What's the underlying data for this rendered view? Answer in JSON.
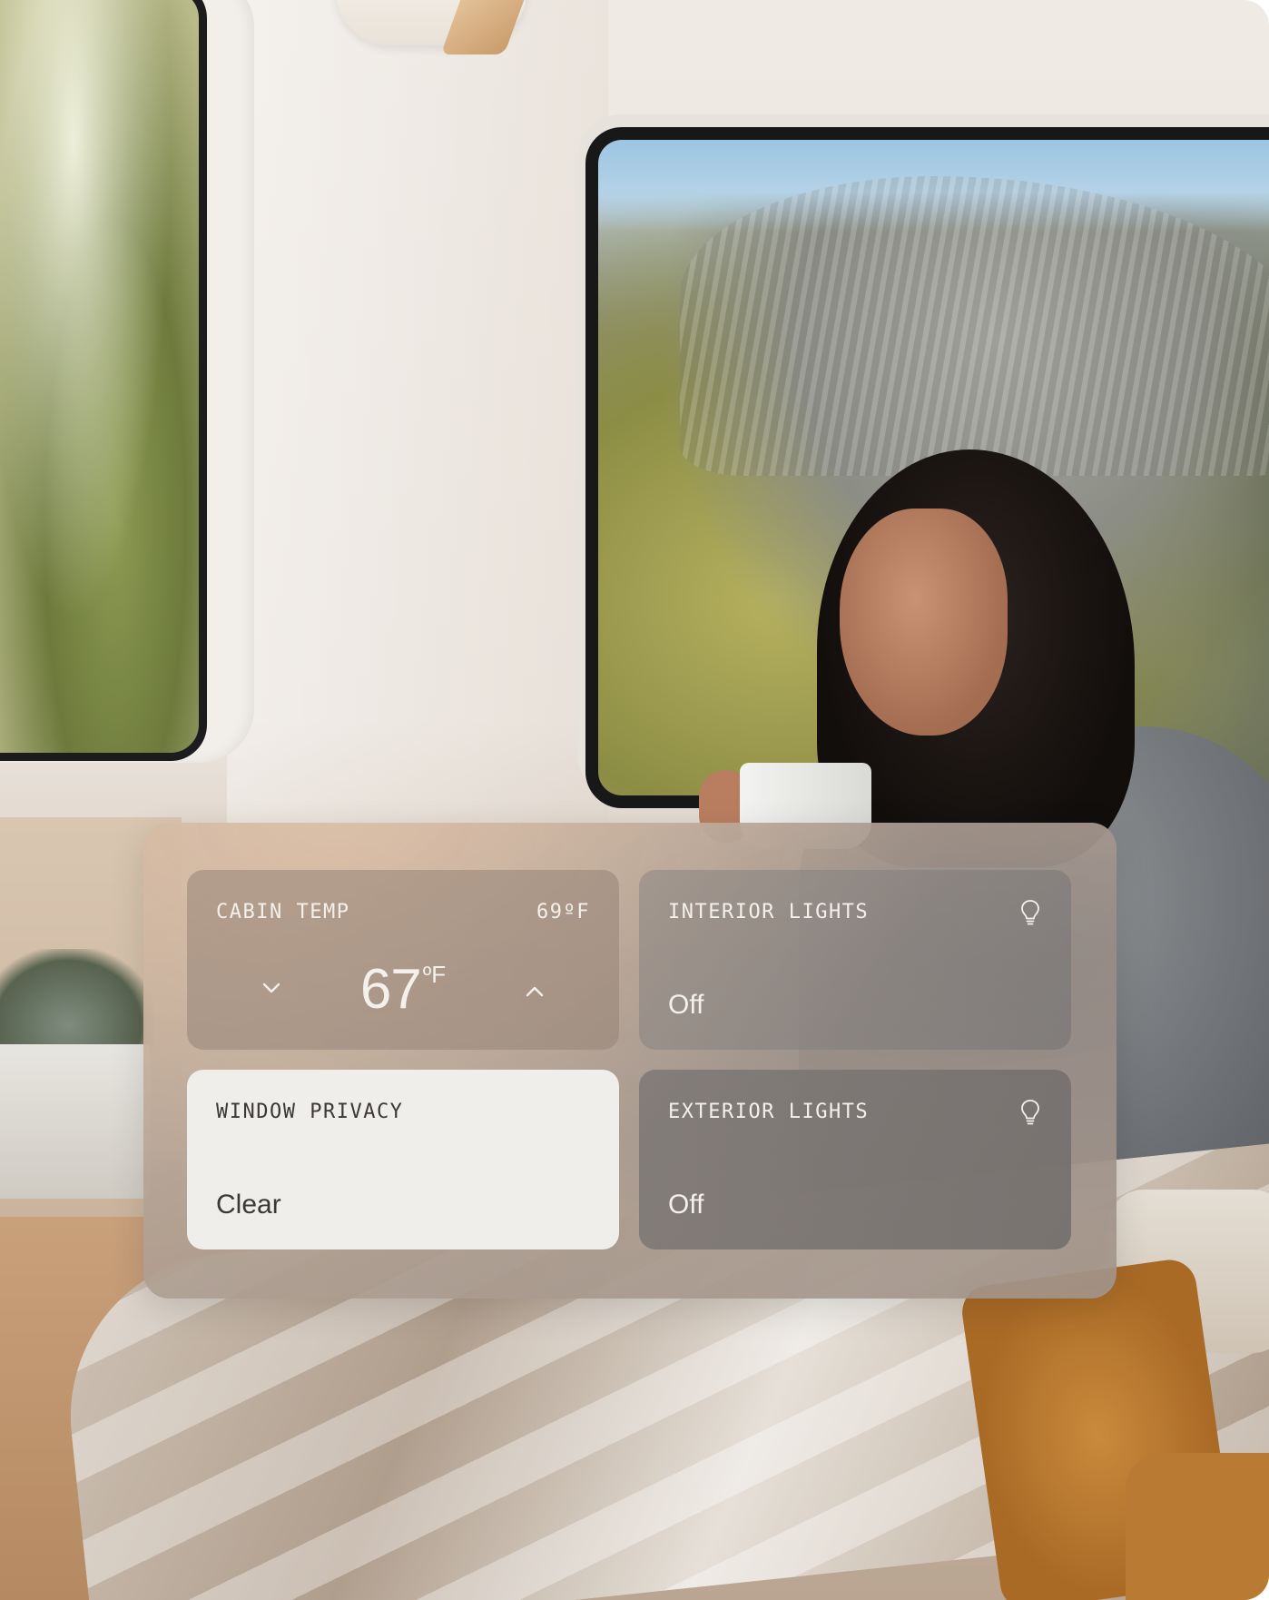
{
  "panel": {
    "cabin_temp": {
      "label": "CABIN TEMP",
      "setpoint": "69ºF",
      "current_value": "67",
      "current_unit": "ºF",
      "decrease_icon": "chevron-down-icon",
      "increase_icon": "chevron-up-icon"
    },
    "interior_lights": {
      "label": "INTERIOR LIGHTS",
      "state": "Off",
      "icon": "lightbulb-icon"
    },
    "window_privacy": {
      "label": "WINDOW PRIVACY",
      "state": "Clear"
    },
    "exterior_lights": {
      "label": "EXTERIOR LIGHTS",
      "state": "Off",
      "icon": "lightbulb-icon"
    }
  },
  "colors": {
    "tile_text_light": "#f4f0ec",
    "tile_text_dark": "#3b3836",
    "selected_tile_bg": "#f0eeea"
  }
}
